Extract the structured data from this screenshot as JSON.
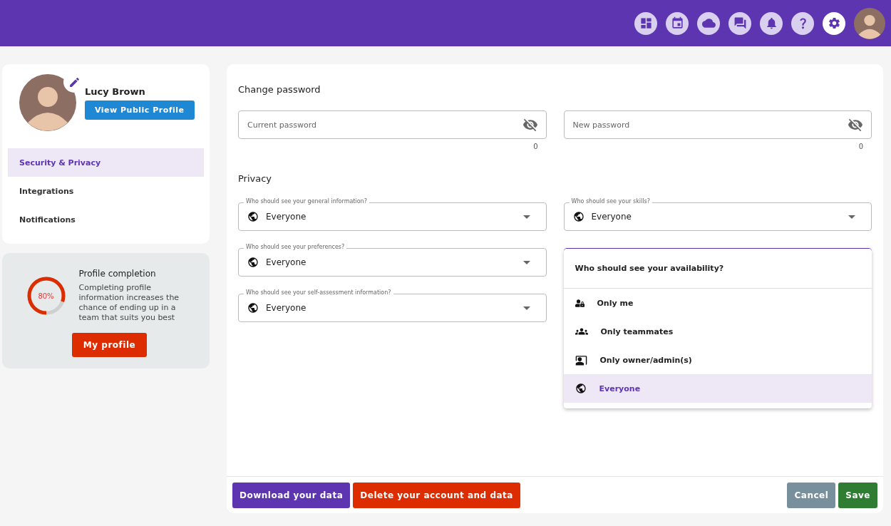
{
  "topbar": {
    "icons": [
      {
        "kind": "dashboard",
        "active": false
      },
      {
        "kind": "calendar",
        "active": false
      },
      {
        "kind": "cloud",
        "active": false
      },
      {
        "kind": "chat",
        "active": false
      },
      {
        "kind": "bell",
        "active": false
      },
      {
        "kind": "help",
        "active": false
      },
      {
        "kind": "settings",
        "active": true
      }
    ]
  },
  "profile": {
    "name": "Lucy Brown",
    "button": "View Public Profile"
  },
  "sidebar": {
    "items": [
      {
        "label": "Security & Privacy",
        "selected": true
      },
      {
        "label": "Integrations",
        "selected": false
      },
      {
        "label": "Notifications",
        "selected": false
      }
    ]
  },
  "completion": {
    "title": "Profile completion",
    "percent": "80%",
    "level": 0.8,
    "text": "Completing profile information increases the chance of ending up in a team that suits you best",
    "button": "My profile"
  },
  "password": {
    "title": "Change password",
    "fields": [
      {
        "placeholder": "Current password",
        "counter": "0"
      },
      {
        "placeholder": "New password",
        "counter": "0"
      }
    ]
  },
  "privacy": {
    "title": "Privacy",
    "selects": [
      {
        "label": "Who should see your general information?",
        "value": "Everyone"
      },
      {
        "label": "Who should see your skills?",
        "value": "Everyone"
      },
      {
        "label": "Who should see your preferences?",
        "value": "Everyone",
        "open": false
      },
      {
        "open": true
      },
      {
        "label": "Who should see your self-assessment information?",
        "value": "Everyone"
      }
    ],
    "menu": {
      "title": "Who should see your availability?",
      "options": [
        {
          "kind": "me",
          "label": "Only me",
          "selected": false
        },
        {
          "kind": "team",
          "label": "Only teammates",
          "selected": false
        },
        {
          "kind": "admin",
          "label": "Only owner/admin(s)",
          "selected": false
        },
        {
          "kind": "everyone",
          "label": "Everyone",
          "selected": true
        }
      ]
    }
  },
  "footer": {
    "left": [
      {
        "kind": "download",
        "label": "Download your data"
      },
      {
        "kind": "delete",
        "label": "Delete your account and data"
      }
    ],
    "right": [
      {
        "kind": "cancel",
        "label": "Cancel"
      },
      {
        "kind": "save",
        "label": "Save"
      }
    ]
  }
}
